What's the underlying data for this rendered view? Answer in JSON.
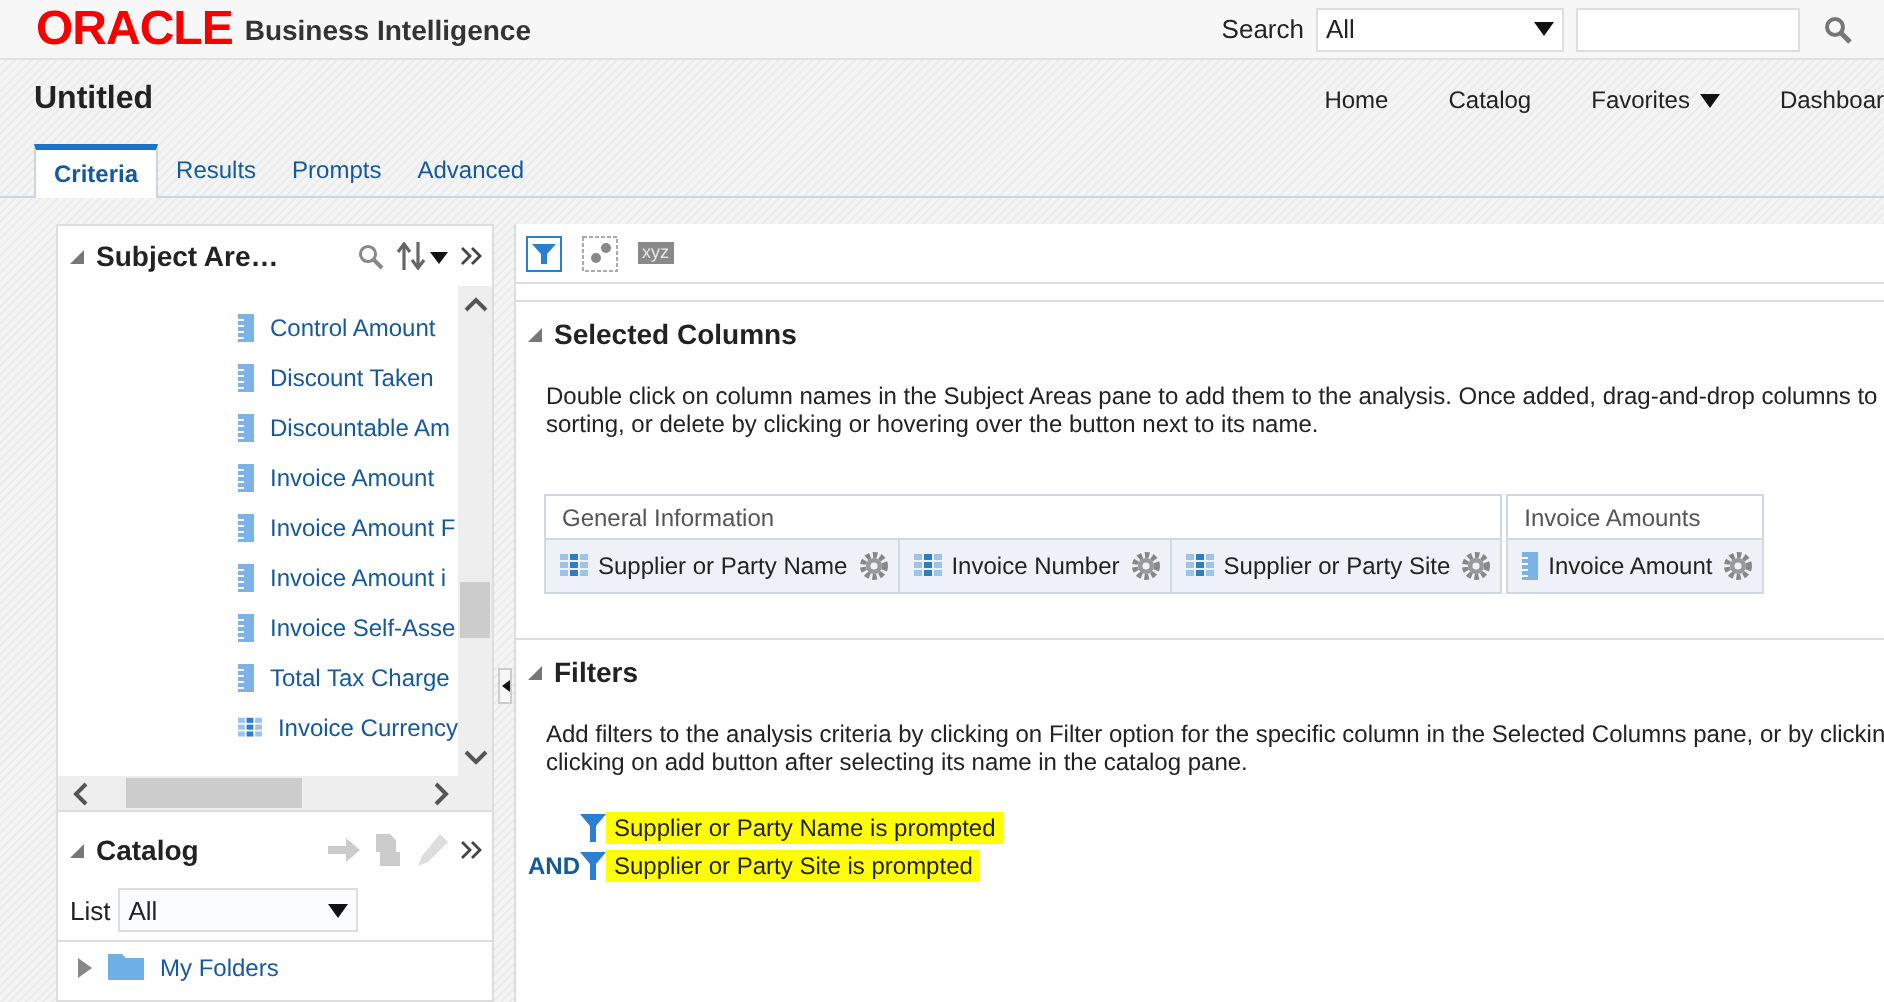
{
  "header": {
    "brand": "ORACLE",
    "product": "Business Intelligence",
    "search_label": "Search",
    "search_scope": "All"
  },
  "page": {
    "title": "Untitled",
    "nav": [
      {
        "label": "Home",
        "menu": false
      },
      {
        "label": "Catalog",
        "menu": false
      },
      {
        "label": "Favorites",
        "menu": true
      },
      {
        "label": "Dashboar",
        "menu": false
      }
    ]
  },
  "tabs": [
    {
      "label": "Criteria",
      "selected": true
    },
    {
      "label": "Results",
      "selected": false
    },
    {
      "label": "Prompts",
      "selected": false
    },
    {
      "label": "Advanced",
      "selected": false
    }
  ],
  "subject_areas": {
    "title": "Subject Are…",
    "items": [
      {
        "label": "Control Amount",
        "kind": "measure"
      },
      {
        "label": "Discount Taken",
        "kind": "measure"
      },
      {
        "label": "Discountable Am",
        "kind": "measure"
      },
      {
        "label": "Invoice Amount",
        "kind": "measure"
      },
      {
        "label": "Invoice Amount F",
        "kind": "measure"
      },
      {
        "label": "Invoice Amount i",
        "kind": "measure"
      },
      {
        "label": "Invoice Self-Asse",
        "kind": "measure"
      },
      {
        "label": "Total Tax Charge",
        "kind": "measure"
      },
      {
        "label": "Invoice Currency",
        "kind": "attribute"
      }
    ]
  },
  "catalog": {
    "title": "Catalog",
    "list_label": "List",
    "list_value": "All",
    "items": [
      {
        "label": "My Folders",
        "expanded": false
      }
    ]
  },
  "toolbar": {
    "text_button": "xyz"
  },
  "selected_columns": {
    "title": "Selected Columns",
    "description_lines": [
      "Double click on column names in the Subject Areas pane to add them to the analysis. Once added, drag-and-drop columns to",
      "sorting, or delete by clicking or hovering over the button next to its name."
    ],
    "groups": [
      {
        "title": "General Information",
        "columns": [
          {
            "name": "Supplier or Party Name",
            "kind": "attribute"
          },
          {
            "name": "Invoice Number",
            "kind": "attribute"
          },
          {
            "name": "Supplier or Party Site",
            "kind": "attribute"
          }
        ]
      },
      {
        "title": "Invoice Amounts",
        "columns": [
          {
            "name": "Invoice Amount",
            "kind": "measure"
          }
        ]
      }
    ]
  },
  "filters": {
    "title": "Filters",
    "description_lines": [
      "Add filters to the analysis criteria by clicking on Filter option for the specific column in the Selected Columns pane, or by clickin",
      "clicking on add button after selecting its name in the catalog pane."
    ],
    "items": [
      {
        "text": "Supplier or Party Name is prompted",
        "highlighted": true
      },
      {
        "operator": "AND",
        "text": "Supplier or Party Site is prompted",
        "highlighted": true
      }
    ]
  }
}
